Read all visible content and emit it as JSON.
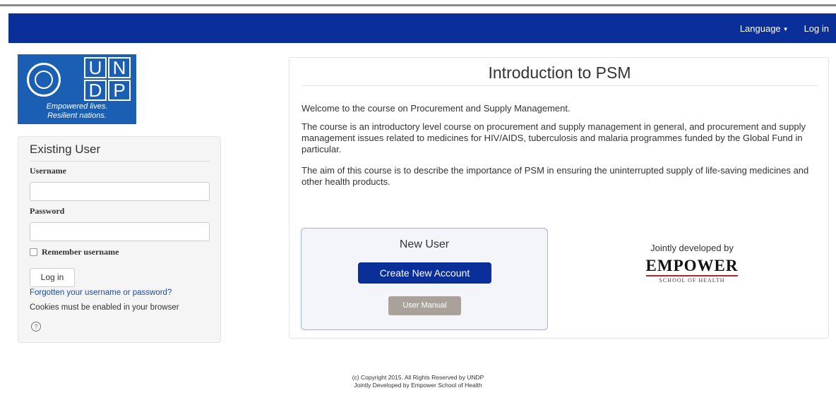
{
  "navbar": {
    "language_label": "Language",
    "login_label": "Log in",
    "background_color": "#0b2f99"
  },
  "logo": {
    "letters": [
      "U",
      "N",
      "D",
      "P"
    ],
    "tagline_line1": "Empowered lives.",
    "tagline_line2": "Resilient nations.",
    "emblem_icon": "un-emblem-icon",
    "color": "#1a5fb4"
  },
  "login": {
    "heading": "Existing User",
    "username_label": "Username",
    "username_value": "",
    "password_label": "Password",
    "password_value": "",
    "remember_label": "Remember username",
    "login_button": "Log in",
    "forgot_link": "Forgotten your username or password?",
    "cookie_note": "Cookies must be enabled in your browser",
    "help_icon": "help-circle-icon"
  },
  "course": {
    "title": "Introduction to PSM",
    "paragraphs": [
      "Welcome to the course on Procurement and Supply Management.",
      "The course is an introductory level course on procurement and supply management in general, and procurement and supply management issues related to medicines for HIV/AIDS, tuberculosis and malaria programmes funded by the Global Fund in particular.",
      "The aim of this course is to describe the importance of PSM in ensuring the uninterrupted supply of life-saving medicines and other health products."
    ],
    "new_user": {
      "title": "New User",
      "create_button": "Create New Account",
      "manual_button": "User Manual"
    },
    "jointly_text": "Jointly developed by",
    "partner_logo_text": "EMPOWER",
    "partner_logo_subtext": "SCHOOL OF HEALTH"
  },
  "footer": {
    "line1": "(c) Copyright 2015. All Rights Reserved by UNDP",
    "line2": "Jointly Developed by Empower School of Health"
  }
}
